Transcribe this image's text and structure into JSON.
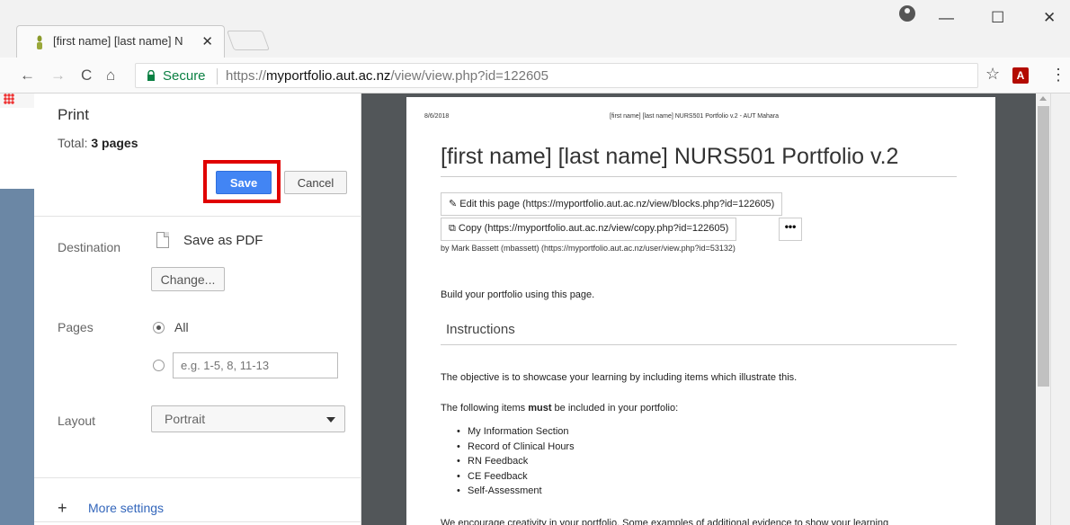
{
  "browser": {
    "tab": {
      "title": "[first name] [last name] N",
      "title_fade": "",
      "close": "✕"
    },
    "window": {
      "account": "account",
      "minimize": "—",
      "maximize": "☐",
      "close": "✕"
    },
    "nav": {
      "back": "←",
      "forward": "→",
      "reload": "C",
      "home": "⌂"
    },
    "address": {
      "secure_label": "Secure",
      "url_prefix": "https://",
      "url_host": "myportfolio.aut.ac.nz",
      "url_path": "/view/view.php?id=122605"
    },
    "toolbar_icons": {
      "star": "☆",
      "pdf": "A",
      "menu": "⋮"
    }
  },
  "print": {
    "title": "Print",
    "total_label": "Total: ",
    "total_value": "3 pages",
    "save_label": "Save",
    "cancel_label": "Cancel",
    "destination_label": "Destination",
    "destination_value": "Save as PDF",
    "change_label": "Change...",
    "pages_label": "Pages",
    "pages_all_label": "All",
    "pages_range_placeholder": "e.g. 1-5, 8, 11-13",
    "layout_label": "Layout",
    "layout_value": "Portrait",
    "more_settings_label": "More settings",
    "plus": "+"
  },
  "preview": {
    "header_date": "8/6/2018",
    "header_title": "[first name] [last name] NURS501 Portfolio v.2 - AUT Mahara",
    "doc_title": "[first name] [last name] NURS501 Portfolio v.2",
    "edit_link": "Edit this page (https://myportfolio.aut.ac.nz/view/blocks.php?id=122605)",
    "copy_link": "Copy (https://myportfolio.aut.ac.nz/view/copy.php?id=122605)",
    "more_button": "•••",
    "byline": "by Mark Bassett (mbassett) (https://myportfolio.aut.ac.nz/user/view.php?id=53132)",
    "intro": "Build your portfolio using this page.",
    "section_heading": "Instructions",
    "objective": "The objective is to showcase your learning by including items which illustrate this.",
    "must_prefix": "The following items ",
    "must_bold": "must",
    "must_suffix": " be included in your portfolio:",
    "items": [
      "My Information Section",
      "Record of Clinical Hours",
      "RN Feedback",
      "CE Feedback",
      "Self-Assessment"
    ],
    "footer_text": "We encourage creativity in your portfolio. Some examples of additional evidence to show your learning"
  },
  "colors": {
    "accent": "#4285f4",
    "highlight": "#e00000",
    "secure": "#0b8043",
    "preview_bg": "#525659"
  }
}
